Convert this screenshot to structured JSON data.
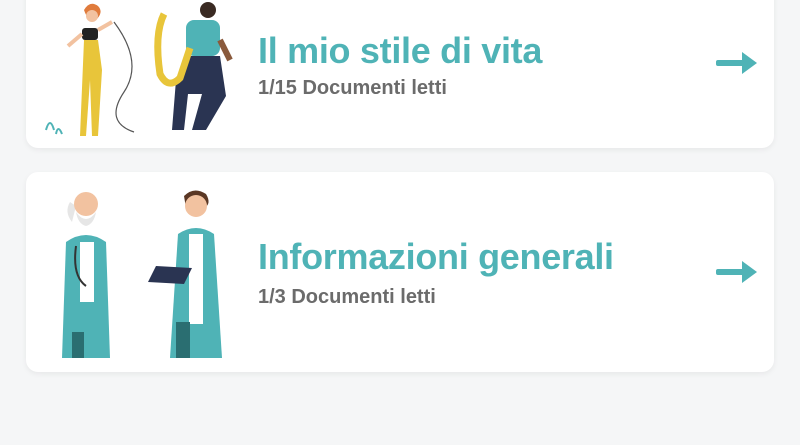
{
  "accent_color": "#4fb3b6",
  "cards": [
    {
      "title": "Il mio stile di vita",
      "subtitle": "1/15 Documenti letti",
      "illustration": "musicians-illustration",
      "action_icon": "arrow-right-icon"
    },
    {
      "title": "Informazioni generali",
      "subtitle": "1/3 Documenti letti",
      "illustration": "doctors-illustration",
      "action_icon": "arrow-right-icon"
    }
  ]
}
